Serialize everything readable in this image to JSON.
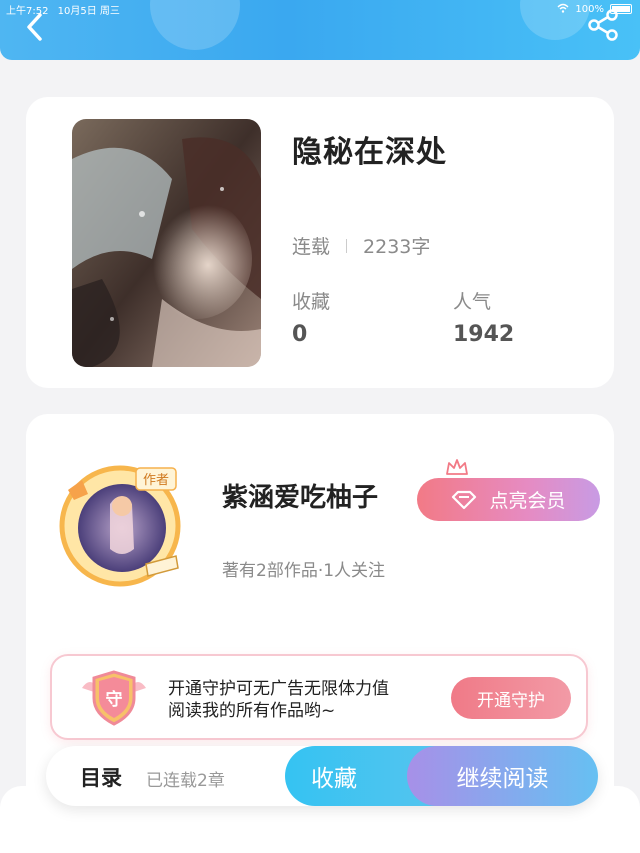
{
  "status_bar": {
    "time": "上午7:52",
    "date": "10月5日 周三",
    "battery": "100%"
  },
  "nav": {
    "back_icon": "chevron-left-icon",
    "share_icon": "share-icon"
  },
  "book": {
    "title": "隐秘在深处",
    "status": "连载",
    "word_count": "2233字",
    "favorites_label": "收藏",
    "favorites_value": "0",
    "popularity_label": "人气",
    "popularity_value": "1942"
  },
  "author": {
    "badge": "作者",
    "name": "紫涵爱吃柚子",
    "summary": "著有2部作品·1人关注",
    "vip_label": "点亮会员"
  },
  "guard": {
    "badge": "守",
    "line1": "开通守护可无广告无限体力值",
    "line2": "阅读我的所有作品哟~",
    "button": "开通守护"
  },
  "bottom_bar": {
    "toc_label": "目录",
    "chapters": "已连载2章",
    "favorite_button": "收藏",
    "read_button": "继续阅读"
  },
  "colors": {
    "primary_blue": "#3aa8f0",
    "pink": "#f27a86",
    "purple": "#c89be4"
  }
}
